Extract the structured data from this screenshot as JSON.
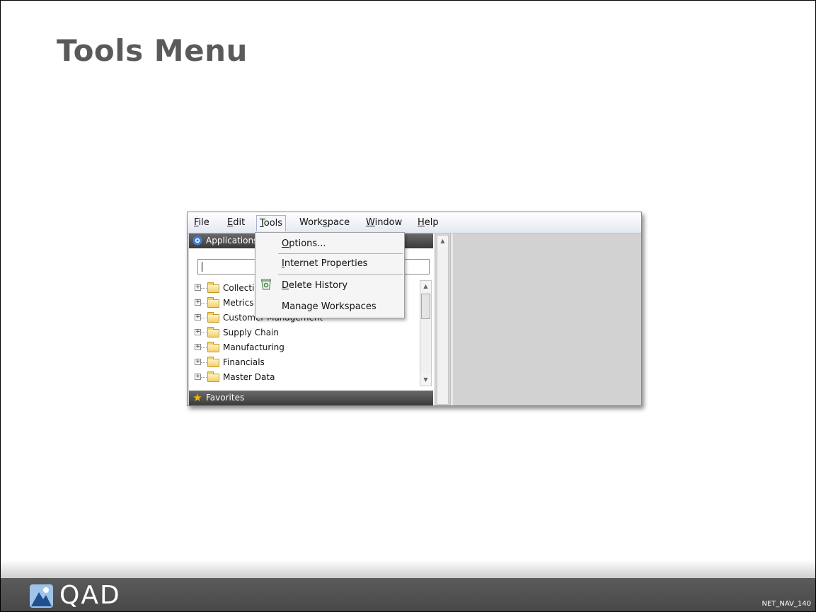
{
  "slide": {
    "title": "Tools Menu",
    "code": "NET_NAV_140",
    "logo_text": "QAD"
  },
  "menubar": {
    "items": [
      {
        "underline": "F",
        "rest": "ile"
      },
      {
        "underline": "E",
        "rest": "dit"
      },
      {
        "underline": "T",
        "rest": "ools"
      },
      {
        "pre": "Work",
        "underline": "s",
        "rest": "pace"
      },
      {
        "underline": "W",
        "rest": "indow"
      },
      {
        "underline": "H",
        "rest": "elp"
      }
    ]
  },
  "applications_panel": {
    "header": "Applications",
    "search_value": "",
    "tree": [
      "Collections",
      "Metrics",
      "Customer Management",
      "Supply Chain",
      "Manufacturing",
      "Financials",
      "Master Data"
    ]
  },
  "favorites_panel": {
    "header": "Favorites"
  },
  "tools_dropdown": {
    "items": [
      {
        "underline": "O",
        "rest": "ptions..."
      },
      {
        "underline": "I",
        "rest": "nternet Properties"
      },
      {
        "underline": "D",
        "rest": "elete History"
      },
      {
        "text": "Manage Workspaces"
      }
    ]
  },
  "icons": {
    "applications": "gear-icon",
    "favorites": "star-icon",
    "delete_history": "recycle-bin-icon",
    "logo": "qad-logo-icon"
  }
}
